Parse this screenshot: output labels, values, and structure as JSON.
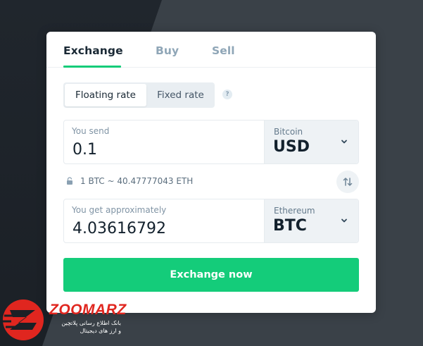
{
  "tabs": [
    {
      "label": "Exchange",
      "active": true
    },
    {
      "label": "Buy",
      "active": false
    },
    {
      "label": "Sell",
      "active": false
    }
  ],
  "rate_mode": {
    "floating_label": "Floating rate",
    "fixed_label": "Fixed rate",
    "selected": "Floating rate",
    "help_label": "?"
  },
  "send": {
    "label": "You send",
    "amount": "0.1",
    "currency_name": "Bitcoin",
    "currency_code": "USD"
  },
  "rate": {
    "text": "1 BTC ~ 40.47777043 ETH",
    "icon": "lock-icon"
  },
  "get": {
    "label": "You get approximately",
    "amount": "4.03616792",
    "currency_name": "Ethereum",
    "currency_code": "BTC"
  },
  "cta": {
    "label": "Exchange now"
  },
  "watermark": {
    "name": "ZOOMARZ",
    "line1": "بانک اطلاع رسانی پلاتچین",
    "line2": "و ارز های دیجیتال"
  },
  "colors": {
    "accent": "#14cc7a",
    "text_dark": "#13212d",
    "muted": "#8fa6b7",
    "brand_watermark": "#e0261f"
  }
}
